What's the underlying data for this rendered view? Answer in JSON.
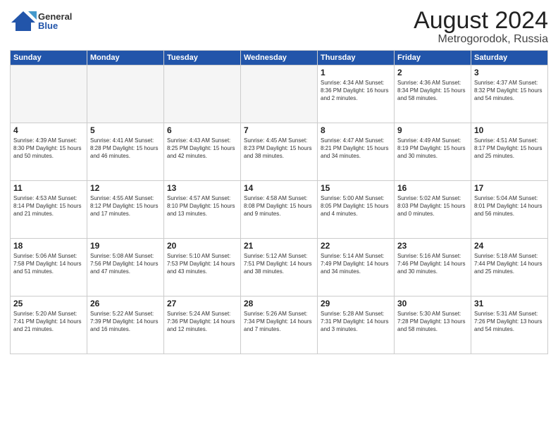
{
  "logo": {
    "general": "General",
    "blue": "Blue"
  },
  "title": {
    "month": "August 2024",
    "location": "Metrogorodok, Russia"
  },
  "headers": [
    "Sunday",
    "Monday",
    "Tuesday",
    "Wednesday",
    "Thursday",
    "Friday",
    "Saturday"
  ],
  "weeks": [
    [
      {
        "day": "",
        "info": ""
      },
      {
        "day": "",
        "info": ""
      },
      {
        "day": "",
        "info": ""
      },
      {
        "day": "",
        "info": ""
      },
      {
        "day": "1",
        "info": "Sunrise: 4:34 AM\nSunset: 8:36 PM\nDaylight: 16 hours\nand 2 minutes."
      },
      {
        "day": "2",
        "info": "Sunrise: 4:36 AM\nSunset: 8:34 PM\nDaylight: 15 hours\nand 58 minutes."
      },
      {
        "day": "3",
        "info": "Sunrise: 4:37 AM\nSunset: 8:32 PM\nDaylight: 15 hours\nand 54 minutes."
      }
    ],
    [
      {
        "day": "4",
        "info": "Sunrise: 4:39 AM\nSunset: 8:30 PM\nDaylight: 15 hours\nand 50 minutes."
      },
      {
        "day": "5",
        "info": "Sunrise: 4:41 AM\nSunset: 8:28 PM\nDaylight: 15 hours\nand 46 minutes."
      },
      {
        "day": "6",
        "info": "Sunrise: 4:43 AM\nSunset: 8:25 PM\nDaylight: 15 hours\nand 42 minutes."
      },
      {
        "day": "7",
        "info": "Sunrise: 4:45 AM\nSunset: 8:23 PM\nDaylight: 15 hours\nand 38 minutes."
      },
      {
        "day": "8",
        "info": "Sunrise: 4:47 AM\nSunset: 8:21 PM\nDaylight: 15 hours\nand 34 minutes."
      },
      {
        "day": "9",
        "info": "Sunrise: 4:49 AM\nSunset: 8:19 PM\nDaylight: 15 hours\nand 30 minutes."
      },
      {
        "day": "10",
        "info": "Sunrise: 4:51 AM\nSunset: 8:17 PM\nDaylight: 15 hours\nand 25 minutes."
      }
    ],
    [
      {
        "day": "11",
        "info": "Sunrise: 4:53 AM\nSunset: 8:14 PM\nDaylight: 15 hours\nand 21 minutes."
      },
      {
        "day": "12",
        "info": "Sunrise: 4:55 AM\nSunset: 8:12 PM\nDaylight: 15 hours\nand 17 minutes."
      },
      {
        "day": "13",
        "info": "Sunrise: 4:57 AM\nSunset: 8:10 PM\nDaylight: 15 hours\nand 13 minutes."
      },
      {
        "day": "14",
        "info": "Sunrise: 4:58 AM\nSunset: 8:08 PM\nDaylight: 15 hours\nand 9 minutes."
      },
      {
        "day": "15",
        "info": "Sunrise: 5:00 AM\nSunset: 8:05 PM\nDaylight: 15 hours\nand 4 minutes."
      },
      {
        "day": "16",
        "info": "Sunrise: 5:02 AM\nSunset: 8:03 PM\nDaylight: 15 hours\nand 0 minutes."
      },
      {
        "day": "17",
        "info": "Sunrise: 5:04 AM\nSunset: 8:01 PM\nDaylight: 14 hours\nand 56 minutes."
      }
    ],
    [
      {
        "day": "18",
        "info": "Sunrise: 5:06 AM\nSunset: 7:58 PM\nDaylight: 14 hours\nand 51 minutes."
      },
      {
        "day": "19",
        "info": "Sunrise: 5:08 AM\nSunset: 7:56 PM\nDaylight: 14 hours\nand 47 minutes."
      },
      {
        "day": "20",
        "info": "Sunrise: 5:10 AM\nSunset: 7:53 PM\nDaylight: 14 hours\nand 43 minutes."
      },
      {
        "day": "21",
        "info": "Sunrise: 5:12 AM\nSunset: 7:51 PM\nDaylight: 14 hours\nand 38 minutes."
      },
      {
        "day": "22",
        "info": "Sunrise: 5:14 AM\nSunset: 7:49 PM\nDaylight: 14 hours\nand 34 minutes."
      },
      {
        "day": "23",
        "info": "Sunrise: 5:16 AM\nSunset: 7:46 PM\nDaylight: 14 hours\nand 30 minutes."
      },
      {
        "day": "24",
        "info": "Sunrise: 5:18 AM\nSunset: 7:44 PM\nDaylight: 14 hours\nand 25 minutes."
      }
    ],
    [
      {
        "day": "25",
        "info": "Sunrise: 5:20 AM\nSunset: 7:41 PM\nDaylight: 14 hours\nand 21 minutes."
      },
      {
        "day": "26",
        "info": "Sunrise: 5:22 AM\nSunset: 7:39 PM\nDaylight: 14 hours\nand 16 minutes."
      },
      {
        "day": "27",
        "info": "Sunrise: 5:24 AM\nSunset: 7:36 PM\nDaylight: 14 hours\nand 12 minutes."
      },
      {
        "day": "28",
        "info": "Sunrise: 5:26 AM\nSunset: 7:34 PM\nDaylight: 14 hours\nand 7 minutes."
      },
      {
        "day": "29",
        "info": "Sunrise: 5:28 AM\nSunset: 7:31 PM\nDaylight: 14 hours\nand 3 minutes."
      },
      {
        "day": "30",
        "info": "Sunrise: 5:30 AM\nSunset: 7:28 PM\nDaylight: 13 hours\nand 58 minutes."
      },
      {
        "day": "31",
        "info": "Sunrise: 5:31 AM\nSunset: 7:26 PM\nDaylight: 13 hours\nand 54 minutes."
      }
    ]
  ]
}
